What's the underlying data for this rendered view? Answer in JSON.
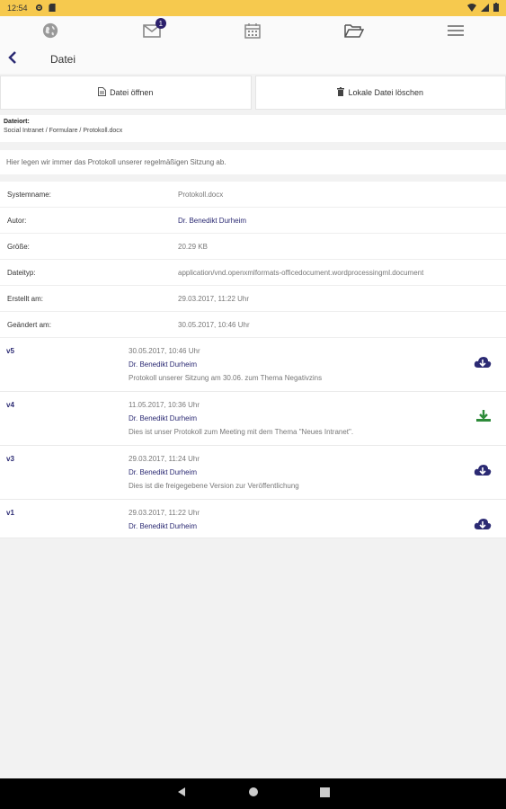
{
  "status": {
    "time": "12:54"
  },
  "nav": {
    "badge_count": "1"
  },
  "header": {
    "title": "Datei"
  },
  "actions": {
    "open_label": "Datei öffnen",
    "delete_label": "Lokale Datei löschen"
  },
  "location": {
    "label": "Dateiort:",
    "path": "Social Intranet / Formulare / Protokoll.docx"
  },
  "description": "Hier legen wir immer das Protokoll unserer regelmäßigen Sitzung ab.",
  "properties": [
    {
      "key": "Systemname:",
      "value": "Protokoll.docx"
    },
    {
      "key": "Autor:",
      "value": "Dr. Benedikt Durheim"
    },
    {
      "key": "Größe:",
      "value": "20.29 KB"
    },
    {
      "key": "Dateityp:",
      "value": "application/vnd.openxmlformats-officedocument.wordprocessingml.document"
    },
    {
      "key": "Erstellt am:",
      "value": "29.03.2017, 11:22 Uhr"
    },
    {
      "key": "Geändert am:",
      "value": "30.05.2017, 10:46 Uhr"
    }
  ],
  "versions": [
    {
      "id": "v5",
      "date": "30.05.2017, 10:46 Uhr",
      "author": "Dr. Benedikt Durheim",
      "note": "Protokoll unserer Sitzung am 30.06. zum Thema Negativzins",
      "icon": "cloud-download-icon"
    },
    {
      "id": "v4",
      "date": "11.05.2017, 10:36 Uhr",
      "author": "Dr. Benedikt Durheim",
      "note": "Dies ist unser Protokoll zum Meeting mit dem Thema \"Neues Intranet\".",
      "icon": "download-icon"
    },
    {
      "id": "v3",
      "date": "29.03.2017, 11:24 Uhr",
      "author": "Dr. Benedikt Durheim",
      "note": "Dies ist die freigegebene Version zur Veröffentlichung",
      "icon": "cloud-download-icon"
    },
    {
      "id": "v1",
      "date": "29.03.2017, 11:22 Uhr",
      "author": "Dr. Benedikt Durheim",
      "note": "",
      "icon": "cloud-download-icon"
    }
  ],
  "colors": {
    "accent": "#2b2a73",
    "statusbar": "#f6c94e",
    "download_green": "#2e8b3a"
  }
}
